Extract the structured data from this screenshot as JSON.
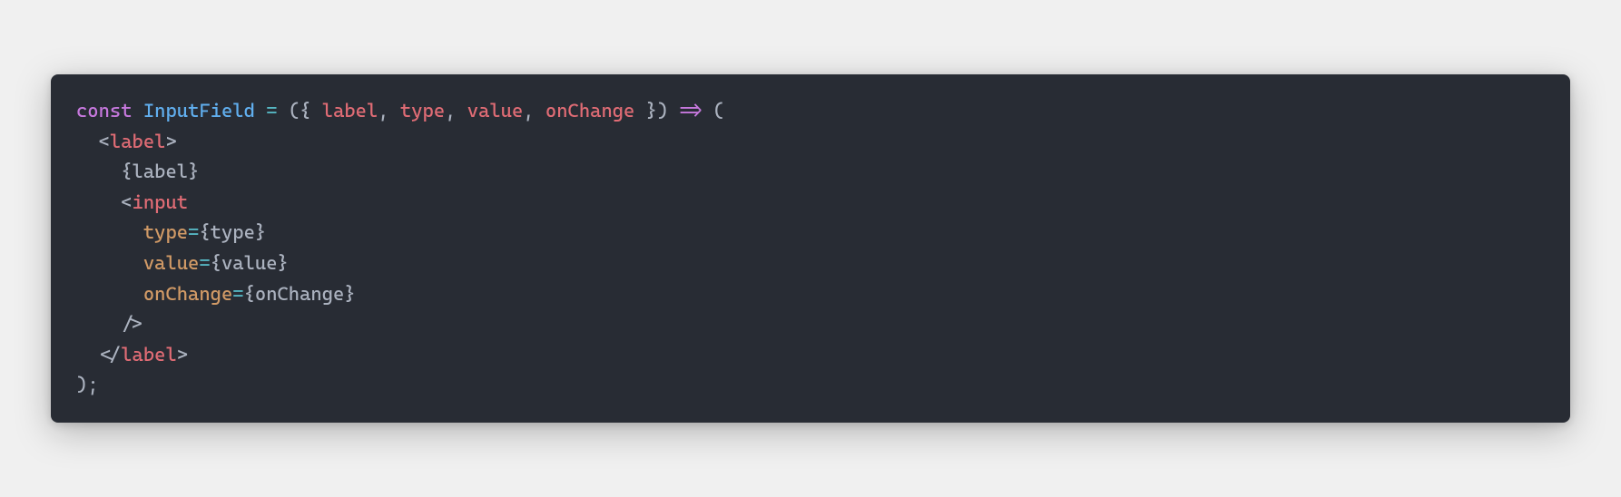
{
  "code": {
    "line1": {
      "const": "const",
      "space1": " ",
      "className": "InputField",
      "space2": " ",
      "eq": "=",
      "space3": " ",
      "openParen": "(",
      "openBrace": "{",
      "space4": " ",
      "p1": "label",
      "c1": ",",
      "space5": " ",
      "p2": "type",
      "c2": ",",
      "space6": " ",
      "p3": "value",
      "c3": ",",
      "space7": " ",
      "p4": "onChange",
      "space8": " ",
      "closeBrace": "}",
      "closeParen": ")",
      "space9": " ",
      "arrow": "=>",
      "space10": " ",
      "openParen2": "("
    },
    "line2": {
      "indent": "  ",
      "lt": "<",
      "tag": "label",
      "gt": ">"
    },
    "line3": {
      "indent": "    ",
      "openBrace": "{",
      "expr": "label",
      "closeBrace": "}"
    },
    "line4": {
      "indent": "    ",
      "lt": "<",
      "tag": "input"
    },
    "line5": {
      "indent": "      ",
      "attr": "type",
      "eq": "=",
      "openBrace": "{",
      "expr": "type",
      "closeBrace": "}"
    },
    "line6": {
      "indent": "      ",
      "attr": "value",
      "eq": "=",
      "openBrace": "{",
      "expr": "value",
      "closeBrace": "}"
    },
    "line7": {
      "indent": "      ",
      "attr": "onChange",
      "eq": "=",
      "openBrace": "{",
      "expr": "onChange",
      "closeBrace": "}"
    },
    "line8": {
      "indent": "    ",
      "selfClose": "/>"
    },
    "line9": {
      "indent": "  ",
      "ltSlash": "</",
      "tag": "label",
      "gt": ">"
    },
    "line10": {
      "closeParen": ")",
      "semi": ";"
    }
  }
}
